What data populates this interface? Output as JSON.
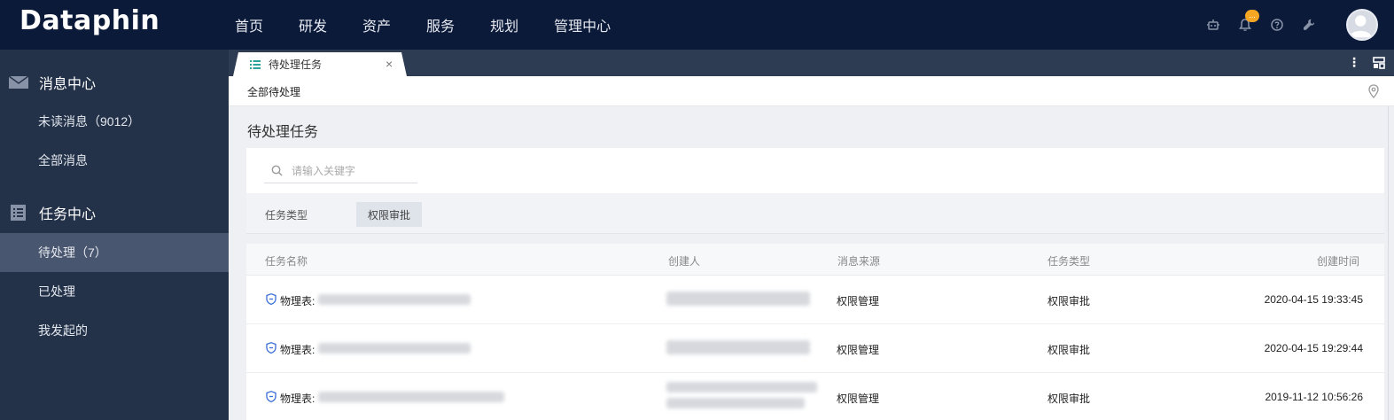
{
  "app": {
    "logo": "Dataphin"
  },
  "topnav": {
    "items": [
      "首页",
      "研发",
      "资产",
      "服务",
      "规划",
      "管理中心"
    ]
  },
  "header_icons": {
    "badge_text": "...",
    "names": [
      "robot-icon",
      "bell-icon",
      "help-icon",
      "wrench-icon"
    ]
  },
  "sidebar": {
    "message_center": "消息中心",
    "unread": "未读消息（9012）",
    "all_messages": "全部消息",
    "task_center": "任务中心",
    "pending": "待处理（7）",
    "processed": "已处理",
    "initiated": "我发起的"
  },
  "tab": {
    "label": "待处理任务",
    "close": "×"
  },
  "breadcrumb": "全部待处理",
  "page_title": "待处理任务",
  "search": {
    "placeholder": "请输入关键字"
  },
  "filter": {
    "label": "任务类型",
    "chip": "权限审批"
  },
  "table": {
    "headers": [
      "任务名称",
      "创建人",
      "消息来源",
      "任务类型",
      "创建时间"
    ],
    "rows": [
      {
        "name_prefix": "物理表:",
        "source": "权限管理",
        "type": "权限审批",
        "time": "2020-04-15 19:33:45"
      },
      {
        "name_prefix": "物理表:",
        "source": "权限管理",
        "type": "权限审批",
        "time": "2020-04-15 19:29:44"
      },
      {
        "name_prefix": "物理表:",
        "source": "权限管理",
        "type": "权限审批",
        "time": "2019-11-12 10:56:26"
      }
    ]
  },
  "colors": {
    "topbar": "#0c1a3a",
    "sidebar": "#243249",
    "active": "#49566f",
    "badge": "#f5a623",
    "shield": "#3b6fd6"
  }
}
